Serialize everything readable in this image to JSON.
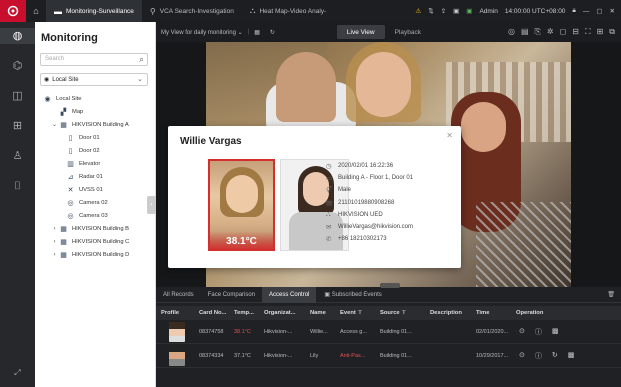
{
  "topbar": {
    "tabs": [
      {
        "label": "Monitoring-Surveillance",
        "icon": "monitor-icon",
        "active": true
      },
      {
        "label": "VCA Search-Investigation",
        "icon": "pin-icon",
        "active": false
      },
      {
        "label": "Heat Map-Video Analy-",
        "icon": "heatmap-icon",
        "active": false
      }
    ],
    "user": "Admin",
    "time": "14:00:00 UTC+08:00"
  },
  "panel": {
    "title": "Monitoring",
    "search_placeholder": "Search",
    "site": "Local Site",
    "tree": [
      {
        "label": "Local Site",
        "level": 0,
        "icon": "site-icon"
      },
      {
        "label": "Map",
        "level": 1,
        "icon": "map-icon"
      },
      {
        "label": "HIKVISION Building A",
        "level": 1,
        "icon": "building-icon",
        "expanded": true
      },
      {
        "label": "Door 01",
        "level": 2,
        "icon": "door-icon"
      },
      {
        "label": "Door 02",
        "level": 2,
        "icon": "door-icon"
      },
      {
        "label": "Elevator",
        "level": 2,
        "icon": "elevator-icon"
      },
      {
        "label": "Radar 01",
        "level": 2,
        "icon": "radar-icon"
      },
      {
        "label": "UVSS 01",
        "level": 2,
        "icon": "uvss-icon"
      },
      {
        "label": "Camera 02",
        "level": 2,
        "icon": "camera-icon"
      },
      {
        "label": "Camera 03",
        "level": 2,
        "icon": "camera-icon"
      },
      {
        "label": "HIKVISION Building B",
        "level": 1,
        "icon": "building-icon",
        "expanded": false
      },
      {
        "label": "HIKVISION Building C",
        "level": 1,
        "icon": "building-icon",
        "expanded": false
      },
      {
        "label": "HIKVISION Building D",
        "level": 1,
        "icon": "building-icon",
        "expanded": false
      }
    ]
  },
  "viewbar": {
    "view_name": "My View for daily monitoring",
    "tabs": [
      "Live View",
      "Playback"
    ]
  },
  "popup": {
    "name": "Willie Vargas",
    "temperature": "38.1°C",
    "details": [
      {
        "icon": "clock-icon",
        "text": "2020/02/01 16:22:36"
      },
      {
        "icon": "door-icon",
        "text": "Building A - Floor 1, Door 01"
      },
      {
        "icon": "gender-icon",
        "text": "Male"
      },
      {
        "icon": "id-card-icon",
        "text": "21101019880908268"
      },
      {
        "icon": "org-icon",
        "text": "HIKVISION UED"
      },
      {
        "icon": "mail-icon",
        "text": "WillieVargas@hikvision.com"
      },
      {
        "icon": "phone-icon",
        "text": "+86 18210302173"
      }
    ]
  },
  "records": {
    "tabs": [
      "All Records",
      "Face Comparison",
      "Access Control"
    ],
    "active_tab": 2,
    "subscribed": "Subscribed Events",
    "columns": [
      "Profile",
      "Card No...",
      "Temp...",
      "Organizat...",
      "Name",
      "Event",
      "Source",
      "Description",
      "Time",
      "Operation"
    ],
    "rows": [
      {
        "card": "08374758",
        "temp": "38.1°C",
        "org": "Hikvision-...",
        "name": "Willie...",
        "event": "Access g...",
        "source": "Building 01...",
        "desc": "",
        "time": "02/01/2020..."
      },
      {
        "card": "08374334",
        "temp": "37.1°C",
        "org": "Hikvision-...",
        "name": "Lily",
        "event": "Anti-Pas...",
        "source": "Building 01...",
        "desc": "",
        "time": "10/29/2017..."
      }
    ]
  }
}
